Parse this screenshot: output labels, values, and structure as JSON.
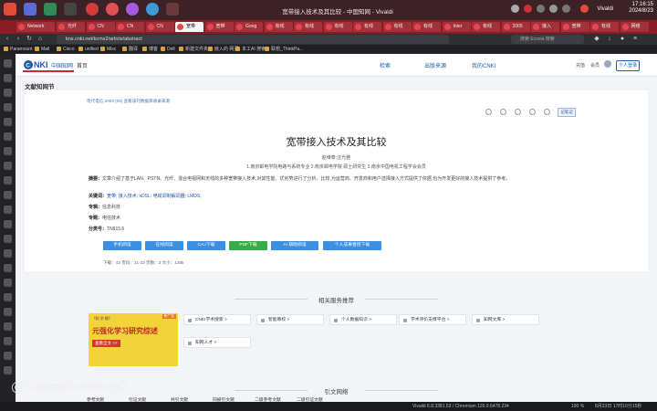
{
  "os": {
    "window_title": "宽带接入技术及其比较 - 中国知网 - Vivaldi",
    "username": "Vivaldi",
    "clock_time": "17:16:15",
    "clock_date": "2024/8/23"
  },
  "tabs": [
    {
      "label": "Network"
    },
    {
      "label": "光纤"
    },
    {
      "label": "CN"
    },
    {
      "label": "CN"
    },
    {
      "label": "CN"
    },
    {
      "label": "宽带"
    },
    {
      "label": "宽带"
    },
    {
      "label": "Goog"
    },
    {
      "label": "有线"
    },
    {
      "label": "有线"
    },
    {
      "label": "有线"
    },
    {
      "label": "有线"
    },
    {
      "label": "有线"
    },
    {
      "label": "有线"
    },
    {
      "label": "Inter"
    },
    {
      "label": "有线"
    },
    {
      "label": "2005"
    },
    {
      "label": "接入"
    },
    {
      "label": "宽带"
    },
    {
      "label": "有线"
    },
    {
      "label": "网络"
    }
  ],
  "address": {
    "url": "kns.cnki.net/kcms2/article/abstract",
    "search_placeholder": "搜索 Ecosia 搜索"
  },
  "bookmarks": [
    "Paramount",
    "Mail",
    "Cisco",
    "unified",
    "Misc",
    "翻译",
    "博客",
    "Dell",
    "新建文件夹",
    "嵌入的 网页",
    "本工AI 搜索",
    "联想_ThinkPa..."
  ],
  "cnki": {
    "home": "首页",
    "nav": [
      "检索",
      "出版来源",
      "我的CNKI"
    ],
    "mini": [
      "充值",
      "会员"
    ],
    "login": "个人登录",
    "section_title": "文献知网节"
  },
  "article": {
    "crumbs": "现代电信  2003 (05)  查看该刊数据库收录来源",
    "record_btn": "记笔记",
    "title": "宽带接入技术及其比较",
    "authors": "赵维泰;沈光雅",
    "affiliations": "1.南京邮电学院电路与系统专业   2.南京邮电学院 硕士研究生   3.南京中国电机工程学会会员",
    "abstract_label": "摘要：",
    "abstract": "文章介绍了基于LAN、PSTN、光纤、混合电视网和无线的多种宽带接入技术,对其性能、优劣势进行了分析、比较,为运营商、开发商和用户选择接入方式提供了依据,也为开发更好的接入技术提供了参考。",
    "keywords_label": "关键词：",
    "keywords": "宽带; 接入技术; xDSL; 电缆调制解调器; LMDS;",
    "topic_label": "专辑：",
    "topic": "信息科技",
    "subject_label": "专题：",
    "subject": "电信技术",
    "class_label": "分类号：",
    "class_no": "TN915.6"
  },
  "downloads": [
    {
      "label": "手机阅读",
      "color": "#3d8fe0"
    },
    {
      "label": "在线阅读",
      "color": "#3d8fe0"
    },
    {
      "label": "CAJ下载",
      "color": "#3d8fe0"
    },
    {
      "label": "PDF下载",
      "color": "#3aab4a"
    },
    {
      "label": "AI 辅助阅读",
      "color": "#3d8fe0"
    },
    {
      "label": "个人成果者授下载",
      "color": "#3d8fe0"
    }
  ],
  "stats": "下载：43    页码：21-23    页数：3    大小：136k",
  "related": {
    "heading": "相关服务推荐",
    "promo_mini": "《知·学·搜》",
    "promo_corner": "新广告",
    "promo_big": "元强化学习研究综述",
    "promo_tag": "查看全文 >>",
    "services": [
      "CNKI学术搜索 >",
      "智能审校 >",
      "个人数据知识 >",
      "学术评价支撑平台 >",
      "知网文库 >",
      "知网人才 >"
    ]
  },
  "cite": {
    "heading": "引文网络",
    "tabs": [
      "参考文献",
      "引证文献",
      "共引文献",
      "同被引文献",
      "二级参考文献",
      "二级引证文献"
    ]
  },
  "status": {
    "left": "Vivaldi 6.8.3381.53 / Chromium 126.0.6478.234",
    "zoom": "100 %",
    "datetime": "8月23日 17时16分15秒"
  },
  "watermark": "@TuskedEvening0"
}
